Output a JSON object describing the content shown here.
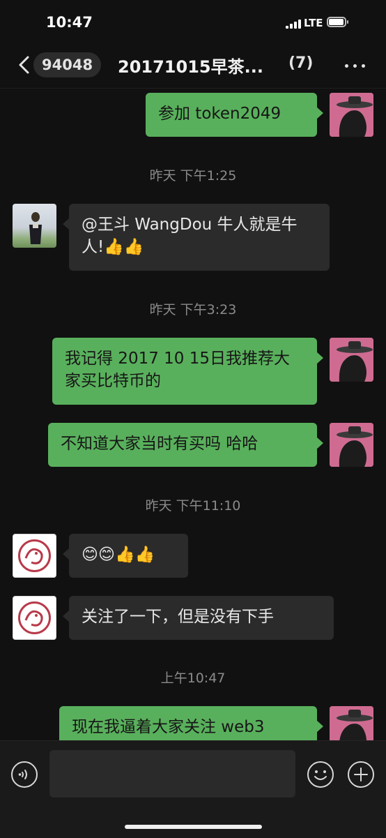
{
  "status_bar": {
    "time": "10:47",
    "network": "LTE"
  },
  "nav": {
    "back_icon": "chevron-left-icon",
    "unread_count": "94048",
    "title": "20171015早茶...",
    "member_count": "(7)",
    "more_icon": "more-dots-icon"
  },
  "messages": [
    {
      "side": "me",
      "text": "参加 token2049"
    },
    {
      "type": "time",
      "text": "昨天 下午1:25"
    },
    {
      "side": "other",
      "text": "@王斗 WangDou 牛人就是牛人!👍👍"
    },
    {
      "type": "time",
      "text": "昨天 下午3:23"
    },
    {
      "side": "me",
      "text": "我记得 2017 10 15日我推荐大家买比特币的"
    },
    {
      "side": "me",
      "text": "不知道大家当时有买吗 哈哈"
    },
    {
      "type": "time",
      "text": "昨天 下午11:10"
    },
    {
      "side": "other",
      "text": "😊😊👍👍"
    },
    {
      "side": "other",
      "text": "关注了一下，但是没有下手"
    },
    {
      "type": "time",
      "text": "上午10:47"
    },
    {
      "side": "me",
      "text": "现在我逼着大家关注 web3"
    }
  ],
  "composer": {
    "voice_icon": "voice-icon",
    "input_value": "",
    "emoji_icon": "emoji-icon",
    "add_icon": "plus-icon"
  },
  "colors": {
    "background": "#111111",
    "outgoing_bubble": "#59b05c",
    "incoming_bubble": "#2b2b2b",
    "timestamp": "#8b8b8b"
  }
}
